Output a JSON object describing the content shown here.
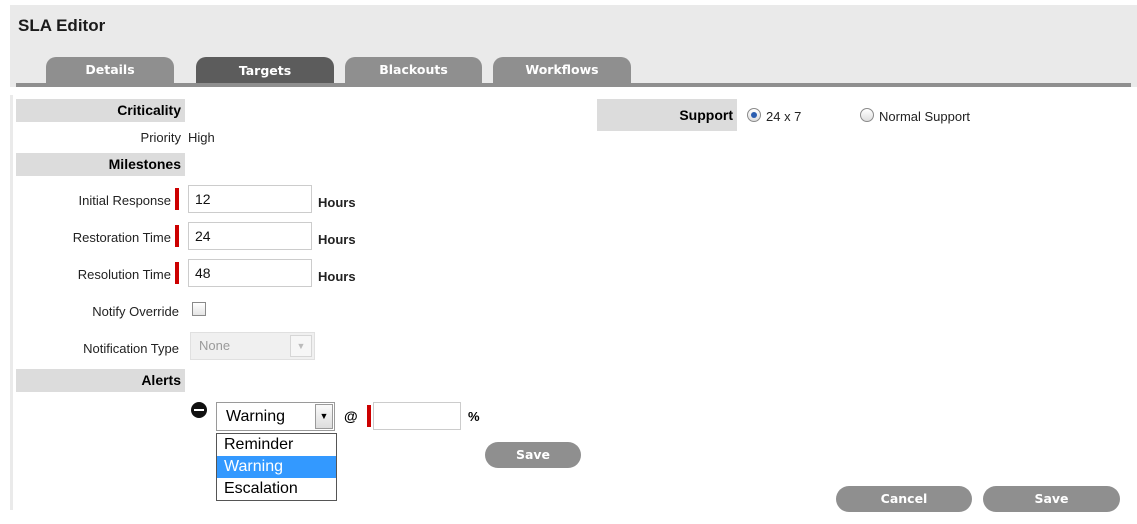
{
  "editor": {
    "title": "SLA Editor"
  },
  "tabs": [
    {
      "label": "Details",
      "active": false
    },
    {
      "label": "Targets",
      "active": true
    },
    {
      "label": "Blackouts",
      "active": false
    },
    {
      "label": "Workflows",
      "active": false
    }
  ],
  "criticality": {
    "header": "Criticality",
    "priority_label": "Priority",
    "priority_value": "High"
  },
  "milestones": {
    "header": "Milestones",
    "initial_response": {
      "label": "Initial Response",
      "value": "12",
      "unit": "Hours"
    },
    "restoration_time": {
      "label": "Restoration Time",
      "value": "24",
      "unit": "Hours"
    },
    "resolution_time": {
      "label": "Resolution Time",
      "value": "48",
      "unit": "Hours"
    },
    "notify_override": {
      "label": "Notify Override",
      "checked": false
    },
    "notification_type": {
      "label": "Notification Type",
      "value": "None",
      "disabled": true
    }
  },
  "support": {
    "label": "Support",
    "options": [
      {
        "label": "24 x 7",
        "selected": true
      },
      {
        "label": "Normal Support",
        "selected": false
      }
    ]
  },
  "alerts": {
    "header": "Alerts",
    "type_value": "Warning",
    "at_symbol": "@",
    "percent_value": "",
    "percent_unit": "%",
    "dropdown_options": [
      {
        "label": "Reminder",
        "highlighted": false
      },
      {
        "label": "Warning",
        "highlighted": true
      },
      {
        "label": "Escalation",
        "highlighted": false
      }
    ],
    "save_label": "Save"
  },
  "footer": {
    "cancel_label": "Cancel",
    "save_label": "Save"
  },
  "colors": {
    "required_marker": "#cc0000",
    "tab_active": "#5c5c5c",
    "tab_inactive": "#8f8f8f",
    "highlight": "#3399ff"
  }
}
